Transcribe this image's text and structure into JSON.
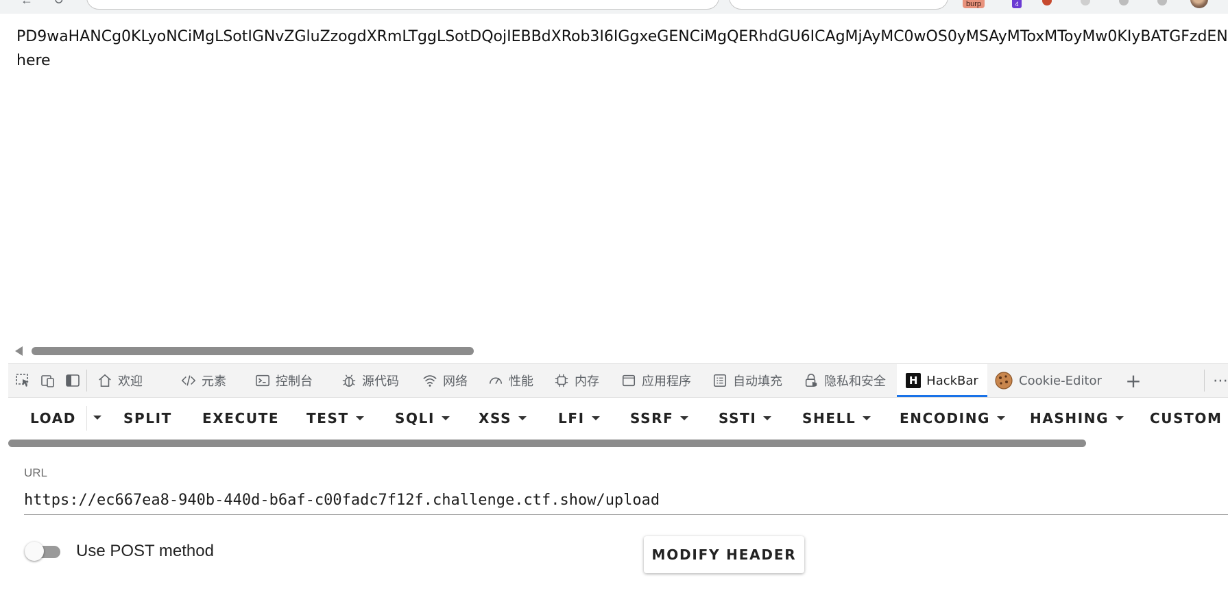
{
  "browser": {
    "extensions": {
      "burp_label": "burp",
      "badge_count": "4"
    }
  },
  "page": {
    "lines": [
      "PD9waHANCg0KLyoNCiMgLSotIGNvZGluZzogdXRmLTggLSotDQojIEBBdXRob3I6IGgxeGENCiMgQERhdGU6ICAgMjAyMC0wOS0yMSAyMToxMToyMw0KIyBATGFzdEN",
      "here"
    ]
  },
  "devtools": {
    "tabs": [
      {
        "label": "欢迎",
        "icon": "home-icon"
      },
      {
        "label": "元素",
        "icon": "code-icon"
      },
      {
        "label": "控制台",
        "icon": "console-icon"
      },
      {
        "label": "源代码",
        "icon": "bug-icon"
      },
      {
        "label": "网络",
        "icon": "wifi-icon"
      },
      {
        "label": "性能",
        "icon": "gauge-icon"
      },
      {
        "label": "内存",
        "icon": "chip-icon"
      },
      {
        "label": "应用程序",
        "icon": "window-icon"
      },
      {
        "label": "自动填充",
        "icon": "form-icon"
      },
      {
        "label": "隐私和安全",
        "icon": "lock-icon"
      },
      {
        "label": "HackBar",
        "icon": "hackbar-icon",
        "active": true
      },
      {
        "label": "Cookie-Editor",
        "icon": "cookie-icon"
      }
    ]
  },
  "hackbar": {
    "menu": [
      "LOAD",
      "SPLIT",
      "EXECUTE",
      "TEST",
      "SQLI",
      "XSS",
      "LFI",
      "SSRF",
      "SSTI",
      "SHELL",
      "ENCODING",
      "HASHING",
      "CUSTOM"
    ],
    "url_label": "URL",
    "url_value": "https://ec667ea8-940b-440d-b6af-c00fadc7f12f.challenge.ctf.show/upload",
    "post_toggle_label": "Use POST method",
    "post_enabled": false,
    "modify_header_label": "MODIFY HEADER"
  }
}
